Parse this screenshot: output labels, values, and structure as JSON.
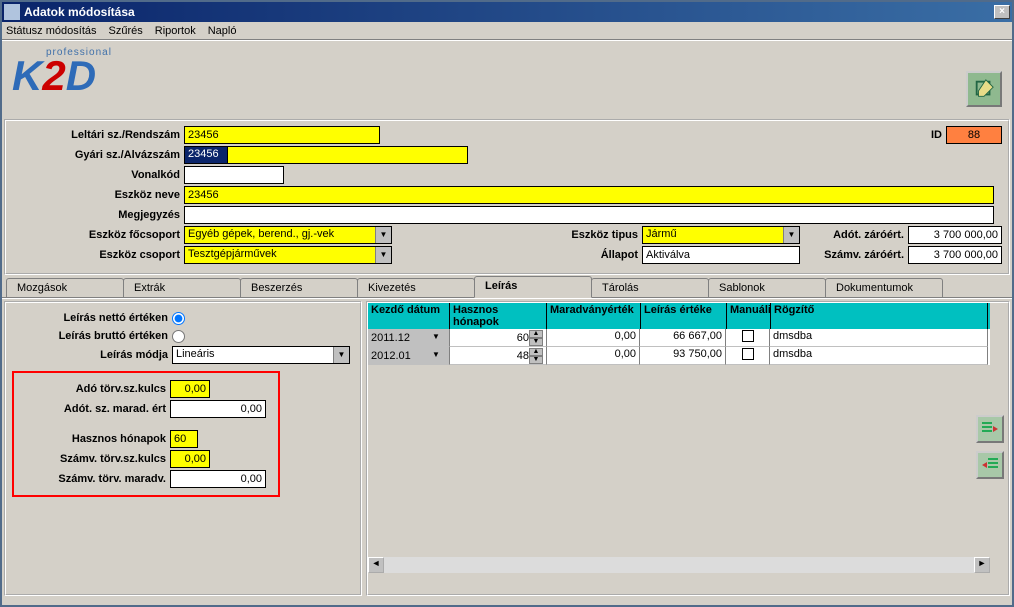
{
  "window": {
    "title": "Adatok módosítása"
  },
  "menubar": [
    "Státusz módosítás",
    "Szűrés",
    "Riportok",
    "Napló"
  ],
  "logo": {
    "top": "professional",
    "main_k": "K",
    "main_2": "2",
    "main_d": "D"
  },
  "header": {
    "labels": {
      "leltari": "Leltári sz./Rendszám",
      "gyari": "Gyári sz./Alvázszám",
      "vonalkod": "Vonalkód",
      "neve": "Eszköz  neve",
      "megj": "Megjegyzés",
      "focsoport": "Eszköz főcsoport",
      "csoport": "Eszköz csoport",
      "tipus": "Eszköz  tipus",
      "allapot": "Állapot",
      "adot": "Adót. záróért.",
      "szamv": "Számv. záróért.",
      "id": "ID"
    },
    "values": {
      "leltari": "23456",
      "gyari": "23456",
      "vonalkod": "",
      "neve": "23456",
      "megj": "",
      "focsoport": "Egyéb gépek, berend., gj.-vek",
      "csoport": "Tesztgépjárművek",
      "tipus": "Jármű",
      "allapot": "Aktiválva",
      "adot": "3 700 000,00",
      "szamv": "3 700 000,00",
      "id": "88"
    }
  },
  "tabs": [
    "Mozgások",
    "Extrák",
    "Beszerzés",
    "Kivezetés",
    "Leírás",
    "Tárolás",
    "Sablonok",
    "Dokumentumok"
  ],
  "active_tab": "Leírás",
  "left": {
    "radio_netto": "Leírás nettó értéken",
    "radio_brutto": "Leírás bruttó értéken",
    "modja_lbl": "Leírás módja",
    "modja_val": "Lineáris",
    "ado_kulcs_lbl": "Adó törv.sz.kulcs",
    "ado_kulcs_val": "0,00",
    "adot_marad_lbl": "Adót. sz. marad. ért",
    "adot_marad_val": "0,00",
    "hasznos_lbl": "Hasznos hónapok",
    "hasznos_val": "60",
    "szamv_kulcs_lbl": "Számv. törv.sz.kulcs",
    "szamv_kulcs_val": "0,00",
    "szamv_marad_lbl": "Számv. törv. maradv.",
    "szamv_marad_val": "0,00"
  },
  "grid": {
    "headers": [
      "Kezdő dátum",
      "Hasznos hónapok",
      "Maradványérték",
      "Leírás értéke",
      "Manuáli",
      "Rögzítő"
    ],
    "rows": [
      {
        "date": "2011.12",
        "months": "60",
        "marad": "0,00",
        "ertek": "66 667,00",
        "man": "",
        "rog": "dmsdba"
      },
      {
        "date": "2012.01",
        "months": "48",
        "marad": "0,00",
        "ertek": "93 750,00",
        "man": "",
        "rog": "dmsdba"
      }
    ]
  }
}
